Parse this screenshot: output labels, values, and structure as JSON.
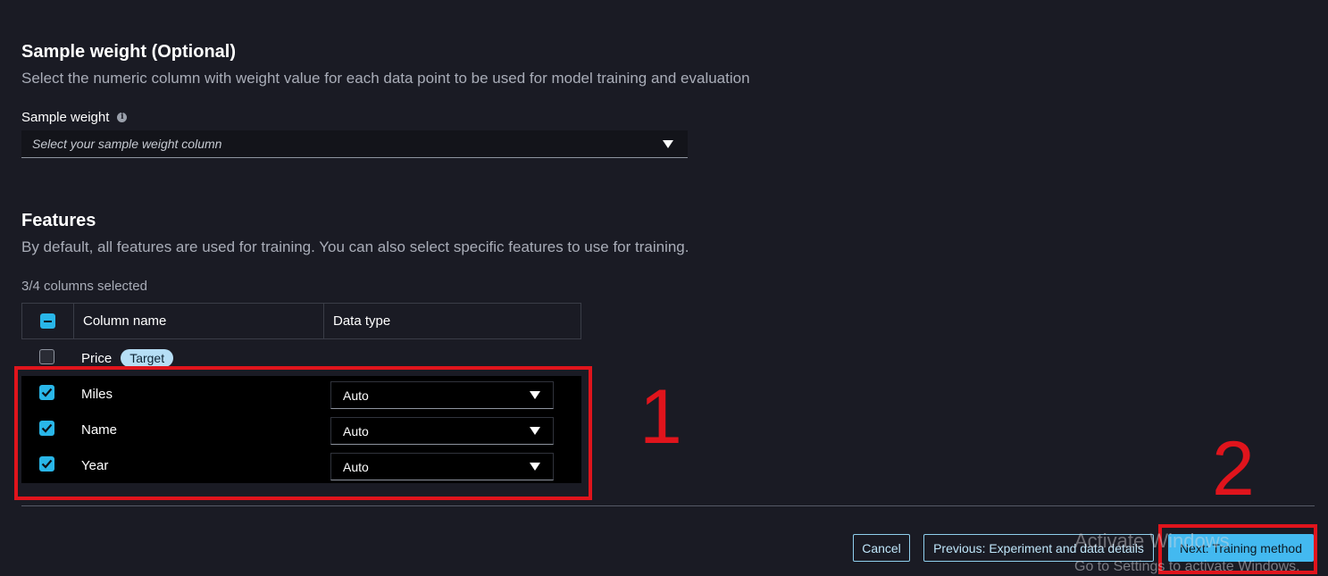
{
  "sample_weight": {
    "title": "Sample weight (Optional)",
    "description": "Select the numeric column with weight value for each data point to be used for model training and evaluation",
    "label": "Sample weight",
    "info_icon": "i",
    "placeholder": "Select your sample weight column"
  },
  "features": {
    "title": "Features",
    "description": "By default, all features are used for training. You can also select specific features to use for training.",
    "columns_selected": "3/4 columns selected",
    "table": {
      "headers": {
        "column_name": "Column name",
        "data_type": "Data type"
      },
      "rows": [
        {
          "name": "Price",
          "badge": "Target",
          "checked": false,
          "data_type": ""
        },
        {
          "name": "Miles",
          "badge": "",
          "checked": true,
          "data_type": "Auto"
        },
        {
          "name": "Name",
          "badge": "",
          "checked": true,
          "data_type": "Auto"
        },
        {
          "name": "Year",
          "badge": "",
          "checked": true,
          "data_type": "Auto"
        }
      ]
    }
  },
  "annotations": {
    "one": "1",
    "two": "2"
  },
  "footer": {
    "cancel": "Cancel",
    "previous": "Previous: Experiment and data details",
    "next": "Next: Training method"
  },
  "watermark": {
    "line1": "Activate Windows",
    "line2": "Go to Settings to activate Windows."
  },
  "colors": {
    "background": "#1a1b24",
    "accent": "#29b6e8",
    "primary_button": "#43b9f0",
    "annotation_red": "#e0141c"
  }
}
